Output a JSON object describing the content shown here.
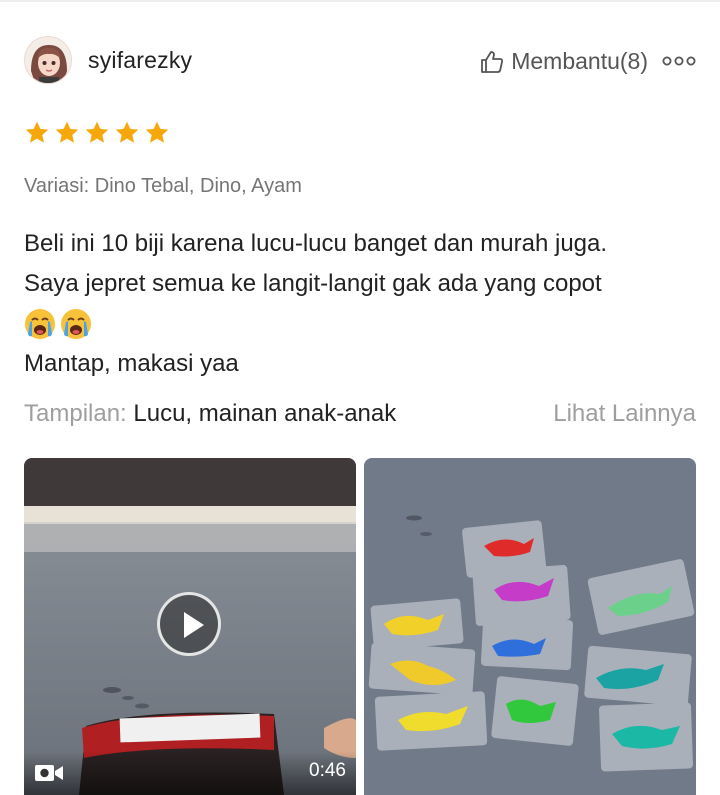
{
  "review": {
    "username": "syifarezky",
    "helpful_label": "Membantu(8)",
    "rating": 5,
    "variant": "Variasi: Dino Tebal, Dino, Ayam",
    "text_line1": "Beli ini 10 biji karena lucu-lucu banget dan murah juga.",
    "text_line2": "Saya jepret semua ke langit-langit gak ada yang copot",
    "emojis": [
      "loudly-crying-face",
      "loudly-crying-face"
    ],
    "text_line3": "Mantap, makasi yaa",
    "attribute_key": "Tampilan:",
    "attribute_value": "Lucu, mainan anak-anak",
    "see_more": "Lihat Lainnya"
  },
  "media": {
    "video_duration": "0:46"
  },
  "colors": {
    "star": "#f6a80b",
    "muted_text": "#9e9e9e",
    "variant_text": "#757575"
  },
  "icons": {
    "helpful": "thumbs-up-icon",
    "more": "more-dots-icon",
    "video": "video-camera-icon",
    "play": "play-icon"
  }
}
